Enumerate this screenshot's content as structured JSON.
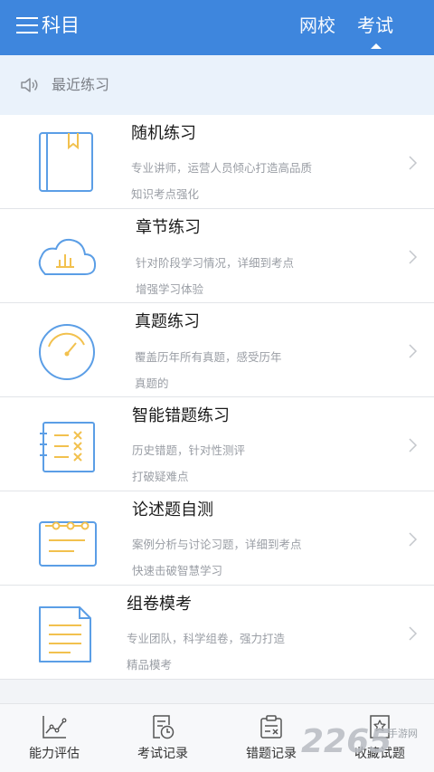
{
  "header": {
    "subject_label": "科目",
    "tabs": [
      {
        "label": "网校",
        "active": false
      },
      {
        "label": "考试",
        "active": true
      }
    ],
    "bg_color": "#3e86dd"
  },
  "recent": {
    "label": "最近练习",
    "icon": "speaker-icon"
  },
  "items": [
    {
      "title": "随机练习",
      "desc1": "专业讲师，运营人员倾心打造高品质",
      "desc2": "知识考点强化",
      "icon": "book-icon"
    },
    {
      "title": "章节练习",
      "desc1": "针对阶段学习情况，详细到考点",
      "desc2": "增强学习体验",
      "icon": "cloud-chart-icon"
    },
    {
      "title": "真题练习",
      "desc1": "覆盖历年所有真题，感受历年",
      "desc2": "真题的",
      "icon": "gauge-icon"
    },
    {
      "title": "智能错题练习",
      "desc1": "历史错题，针对性测评",
      "desc2": "打破疑难点",
      "icon": "mistake-notebook-icon"
    },
    {
      "title": "论述题自测",
      "desc1": "案例分析与讨论习题，详细到考点",
      "desc2": "快速击破智慧学习",
      "icon": "calendar-note-icon"
    },
    {
      "title": "组卷模考",
      "desc1": "专业团队，科学组卷，强力打造",
      "desc2": "精品模考",
      "icon": "paper-document-icon"
    }
  ],
  "tabbar": [
    {
      "label": "能力评估",
      "icon": "chart-line-icon"
    },
    {
      "label": "考试记录",
      "icon": "exam-record-icon"
    },
    {
      "label": "错题记录",
      "icon": "mistake-record-icon"
    },
    {
      "label": "收藏试题",
      "icon": "favorite-icon"
    }
  ],
  "watermark": {
    "main": "2265",
    "sub": "手游网"
  }
}
